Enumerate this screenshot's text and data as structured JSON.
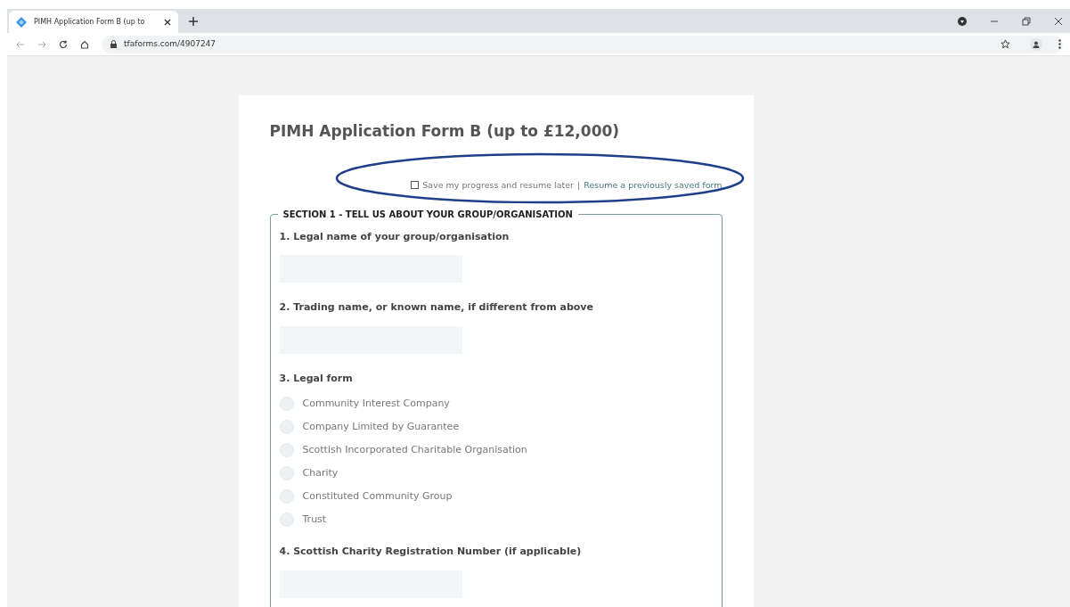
{
  "browser": {
    "tab": {
      "title": "PIMH Application Form B (up to"
    },
    "url": "tfaforms.com/4907247"
  },
  "form": {
    "title": "PIMH Application Form B (up to £12,000)",
    "save": {
      "label": "Save my progress and resume later",
      "checked": false,
      "separator": "|",
      "link": "Resume a previously saved form"
    },
    "section": {
      "legend": "SECTION 1 - TELL US ABOUT YOUR GROUP/ORGANISATION",
      "questions": [
        {
          "kind": "text",
          "label": "1. Legal name of your group/organisation"
        },
        {
          "kind": "text",
          "label": "2. Trading name, or known name, if different from above"
        },
        {
          "kind": "radio",
          "label": "3. Legal form",
          "options": [
            {
              "label": "Community Interest Company",
              "selected": false
            },
            {
              "label": "Company Limited by Guarantee",
              "selected": false
            },
            {
              "label": "Scottish Incorporated Charitable Organisation",
              "selected": false
            },
            {
              "label": "Charity",
              "selected": false
            },
            {
              "label": "Constituted Community Group",
              "selected": false
            },
            {
              "label": "Trust",
              "selected": false
            }
          ]
        },
        {
          "kind": "text",
          "label": "4. Scottish Charity Registration Number (if applicable)"
        }
      ]
    }
  }
}
